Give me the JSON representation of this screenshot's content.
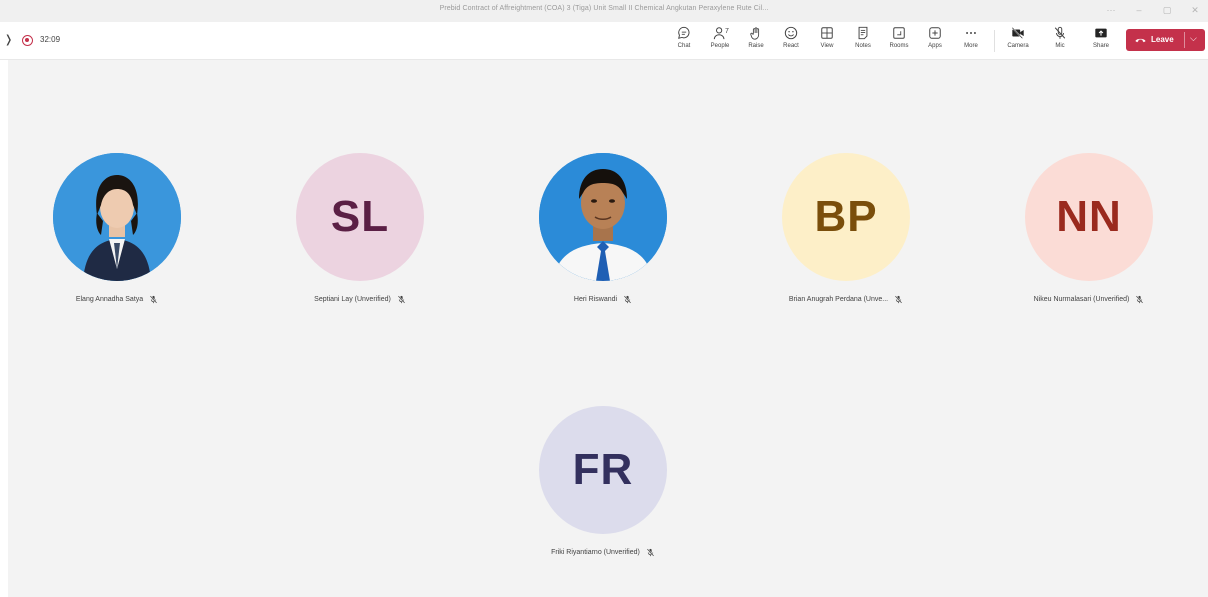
{
  "window": {
    "title": "Prebid Contract of Affreightment (COA) 3 (Tiga) Unit Small II Chemical Angkutan Peraxylene Rute Cil...",
    "controls": [
      "···",
      "–",
      "▢",
      "✕"
    ]
  },
  "meeting": {
    "timer": "32:09"
  },
  "toolbar": {
    "tools": [
      {
        "label": "Chat",
        "icon": "chat-icon"
      },
      {
        "label": "People",
        "icon": "people-icon",
        "badge": "7"
      },
      {
        "label": "Raise",
        "icon": "raise-hand-icon"
      },
      {
        "label": "React",
        "icon": "react-icon"
      },
      {
        "label": "View",
        "icon": "view-grid-icon"
      },
      {
        "label": "Notes",
        "icon": "notes-icon"
      },
      {
        "label": "Rooms",
        "icon": "rooms-icon"
      },
      {
        "label": "Apps",
        "icon": "apps-icon"
      },
      {
        "label": "More",
        "icon": "more-icon"
      }
    ],
    "media": [
      {
        "label": "Camera",
        "icon": "camera-off-icon"
      },
      {
        "label": "Mic",
        "icon": "mic-off-icon"
      },
      {
        "label": "Share",
        "icon": "share-icon"
      }
    ],
    "leave_label": "Leave"
  },
  "participants": [
    {
      "name": "Elang Annadha Satya",
      "avatar": "photo",
      "photo_bg": "#2f8fd6"
    },
    {
      "name": "Septiani Lay (Unverified)",
      "initials": "SL",
      "bg": "#ecd3e0",
      "fg": "#5b1f45"
    },
    {
      "name": "Heri Riswandi",
      "avatar": "photo",
      "photo_bg": "#2a8ad6"
    },
    {
      "name": "Brian Anugrah Perdana (Unve...",
      "initials": "BP",
      "bg": "#fdefc8",
      "fg": "#7a4e0b"
    },
    {
      "name": "Nikeu Nurmalasari (Unverified)",
      "initials": "NN",
      "bg": "#fbdcd6",
      "fg": "#9a2a1e"
    },
    {
      "name": "Friki Riyantiarno (Unverified)",
      "initials": "FR",
      "bg": "#dcdcec",
      "fg": "#33305e"
    }
  ]
}
